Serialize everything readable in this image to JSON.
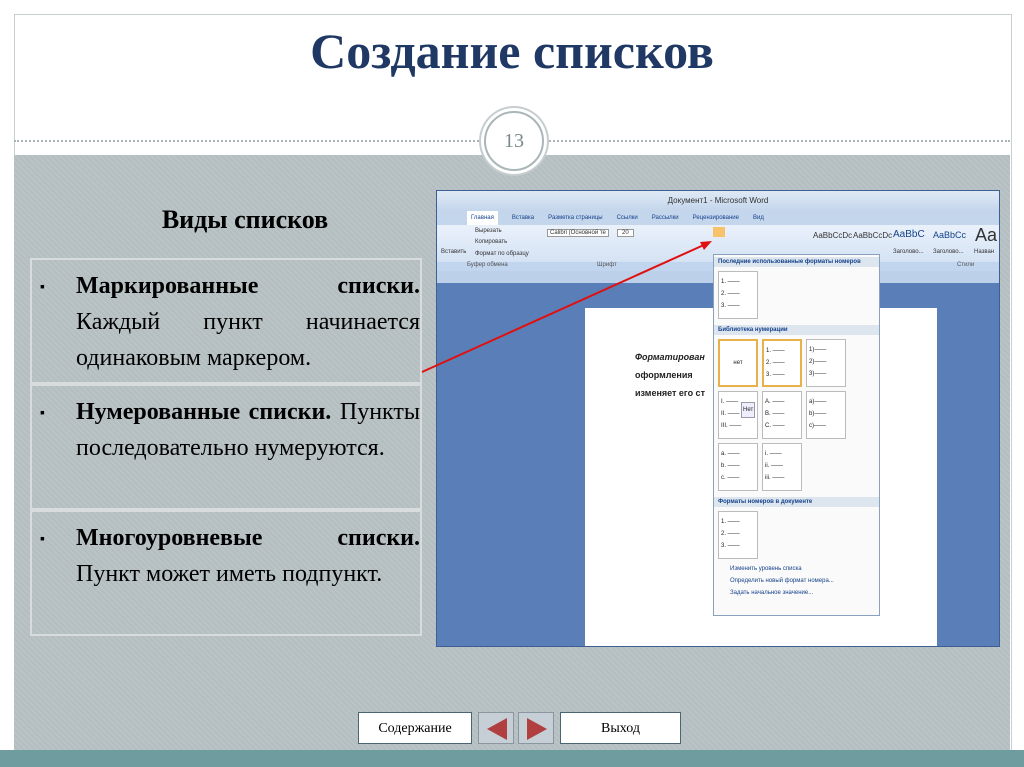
{
  "slide": {
    "title": "Создание  списков",
    "number": "13",
    "subtitle": "Виды списков"
  },
  "items": [
    {
      "bold": "Маркированные списки.",
      "text": "Каждый пункт начинается одинаковым маркером."
    },
    {
      "bold": "Нумерованные списки.",
      "text": "Пункты последовательно нумеруются."
    },
    {
      "bold": "Многоуровневые списки.",
      "text": "Пункт может иметь подпункт."
    }
  ],
  "bullet": "▪",
  "word": {
    "title": "Документ1 - Microsoft Word",
    "tabs": [
      "Главная",
      "Вставка",
      "Разметка страницы",
      "Ссылки",
      "Рассылки",
      "Рецензирование",
      "Вид"
    ],
    "clipboard": {
      "paste": "Вставить",
      "cut": "Вырезать",
      "copy": "Копировать",
      "format": "Формат по образцу",
      "group": "Буфер обмена"
    },
    "font": {
      "name": "Calibri (Основной те",
      "size": "20",
      "group": "Шрифт"
    },
    "styles": {
      "samples": [
        "AaBbCcDc",
        "AaBbCcDc",
        "AaBbC",
        "AaBbCc",
        "Aa"
      ],
      "names": [
        "",
        "",
        "Заголово...",
        "Заголово...",
        "Назван"
      ],
      "group": "Стили"
    },
    "doc_lines": [
      "Форматирован",
      "оформления",
      "изменяет его ст"
    ],
    "menu": {
      "recent": "Последние использованные форматы номеров",
      "library": "Библиотека нумерации",
      "document": "Форматы номеров в документе",
      "cells_recent": [
        "1. ——\n2. ——\n3. ——"
      ],
      "cells_library": [
        "нет",
        "1. ——\n2. ——\n3. ——",
        "1)——\n2)——\n3)——",
        "I. ——\nII. ——\nIII. ——",
        "A. ——\nB. ——\nC. ——",
        "a)——\nb)——\nc)——",
        "a. ——\nb. ——\nc. ——",
        "i. ——\nii. ——\niii. ——"
      ],
      "tooltip": "Нет",
      "cells_doc": [
        "1. ——\n2. ——\n3. ——"
      ],
      "actions": [
        "Изменить уровень списка",
        "Определить новый формат номера...",
        "Задать начальное значение..."
      ]
    }
  },
  "nav": {
    "contents": "Содержание",
    "exit": "Выход"
  }
}
